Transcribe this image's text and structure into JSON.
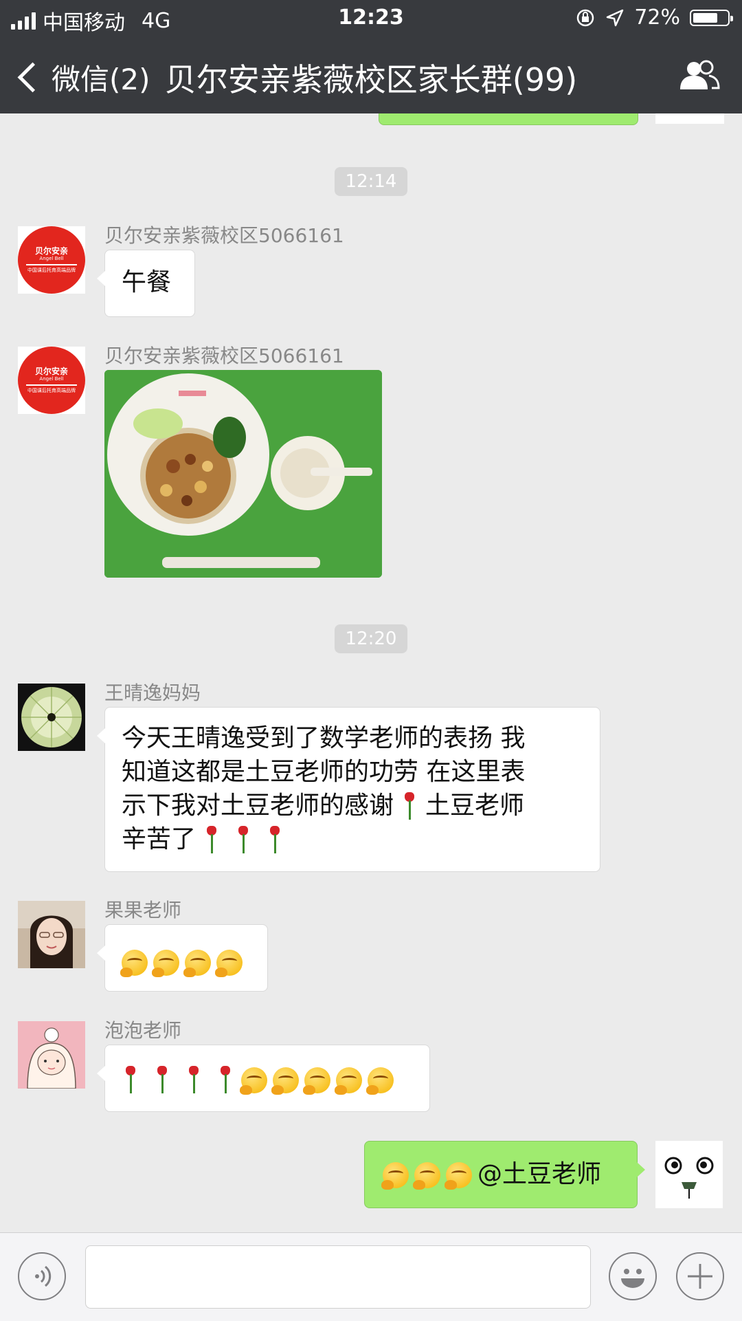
{
  "status": {
    "carrier": "中国移动",
    "network": "4G",
    "time": "12:23",
    "battery": "72%",
    "battery_level": 0.72
  },
  "nav": {
    "back_label": "微信(2)",
    "title": "贝尔安亲紫薇校区家长群(99)"
  },
  "chat": {
    "time1": "12:14",
    "msg1": {
      "sender": "贝尔安亲紫薇校区5066161",
      "text": "午餐"
    },
    "msg2": {
      "sender": "贝尔安亲紫薇校区5066161",
      "image": "lunch-photo"
    },
    "logo": {
      "line1": "贝尔安亲",
      "line2": "Angel Bell",
      "line3": "中国课后托育高端品牌"
    },
    "time2": "12:20",
    "msg3": {
      "sender": "王晴逸妈妈",
      "line1": "今天王晴逸受到了数学老师的表扬 我",
      "line2": "知道这都是土豆老师的功劳 在这里表",
      "line3": "示下我对土豆老师的感谢",
      "line3b": "土豆老师",
      "line4": "辛苦了"
    },
    "msg4": {
      "sender": "果果老师"
    },
    "msg5": {
      "sender": "泡泡老师"
    },
    "msg6": {
      "text": "@土豆老师"
    }
  },
  "colors": {
    "header": "#383a3e",
    "background": "#ebebeb",
    "my_bubble": "#9feb6f",
    "logo_red": "#e2261e"
  },
  "icons": [
    "back-chevron-icon",
    "group-members-icon",
    "voice-icon",
    "emoji-icon",
    "plus-icon",
    "rose-emoji",
    "hug-emoji"
  ]
}
